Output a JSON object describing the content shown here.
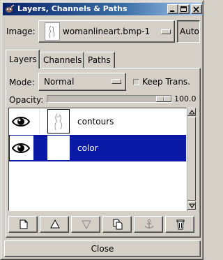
{
  "window": {
    "title": "Layers, Channels & Paths"
  },
  "image_row": {
    "label": "Image:",
    "selected": "womanlineart.bmp-1",
    "auto_label": "Auto"
  },
  "tabs": [
    {
      "label": "Layers",
      "active": true
    },
    {
      "label": "Channels",
      "active": false
    },
    {
      "label": "Paths",
      "active": false
    }
  ],
  "layers_panel": {
    "mode_label": "Mode:",
    "mode_value": "Normal",
    "keep_trans_label": "Keep Trans.",
    "keep_trans_checked": false,
    "opacity_label": "Opacity:",
    "opacity_value": "100.0",
    "opacity_fraction": 1.0,
    "layers": [
      {
        "name": "contours",
        "visible": true,
        "selected": false,
        "thumb": "line-art"
      },
      {
        "name": "color",
        "visible": true,
        "selected": true,
        "thumb": "blank"
      }
    ],
    "actions": [
      {
        "icon": "new-layer-icon"
      },
      {
        "icon": "raise-layer-icon"
      },
      {
        "icon": "lower-layer-icon"
      },
      {
        "icon": "duplicate-layer-icon"
      },
      {
        "icon": "anchor-icon"
      },
      {
        "icon": "trash-icon"
      }
    ]
  },
  "footer": {
    "close_label": "Close"
  },
  "colors": {
    "face": "#d4d0c8",
    "titlebar_start": "#0a246a",
    "titlebar_end": "#a6caf0",
    "selection": "#0a1aa6"
  }
}
